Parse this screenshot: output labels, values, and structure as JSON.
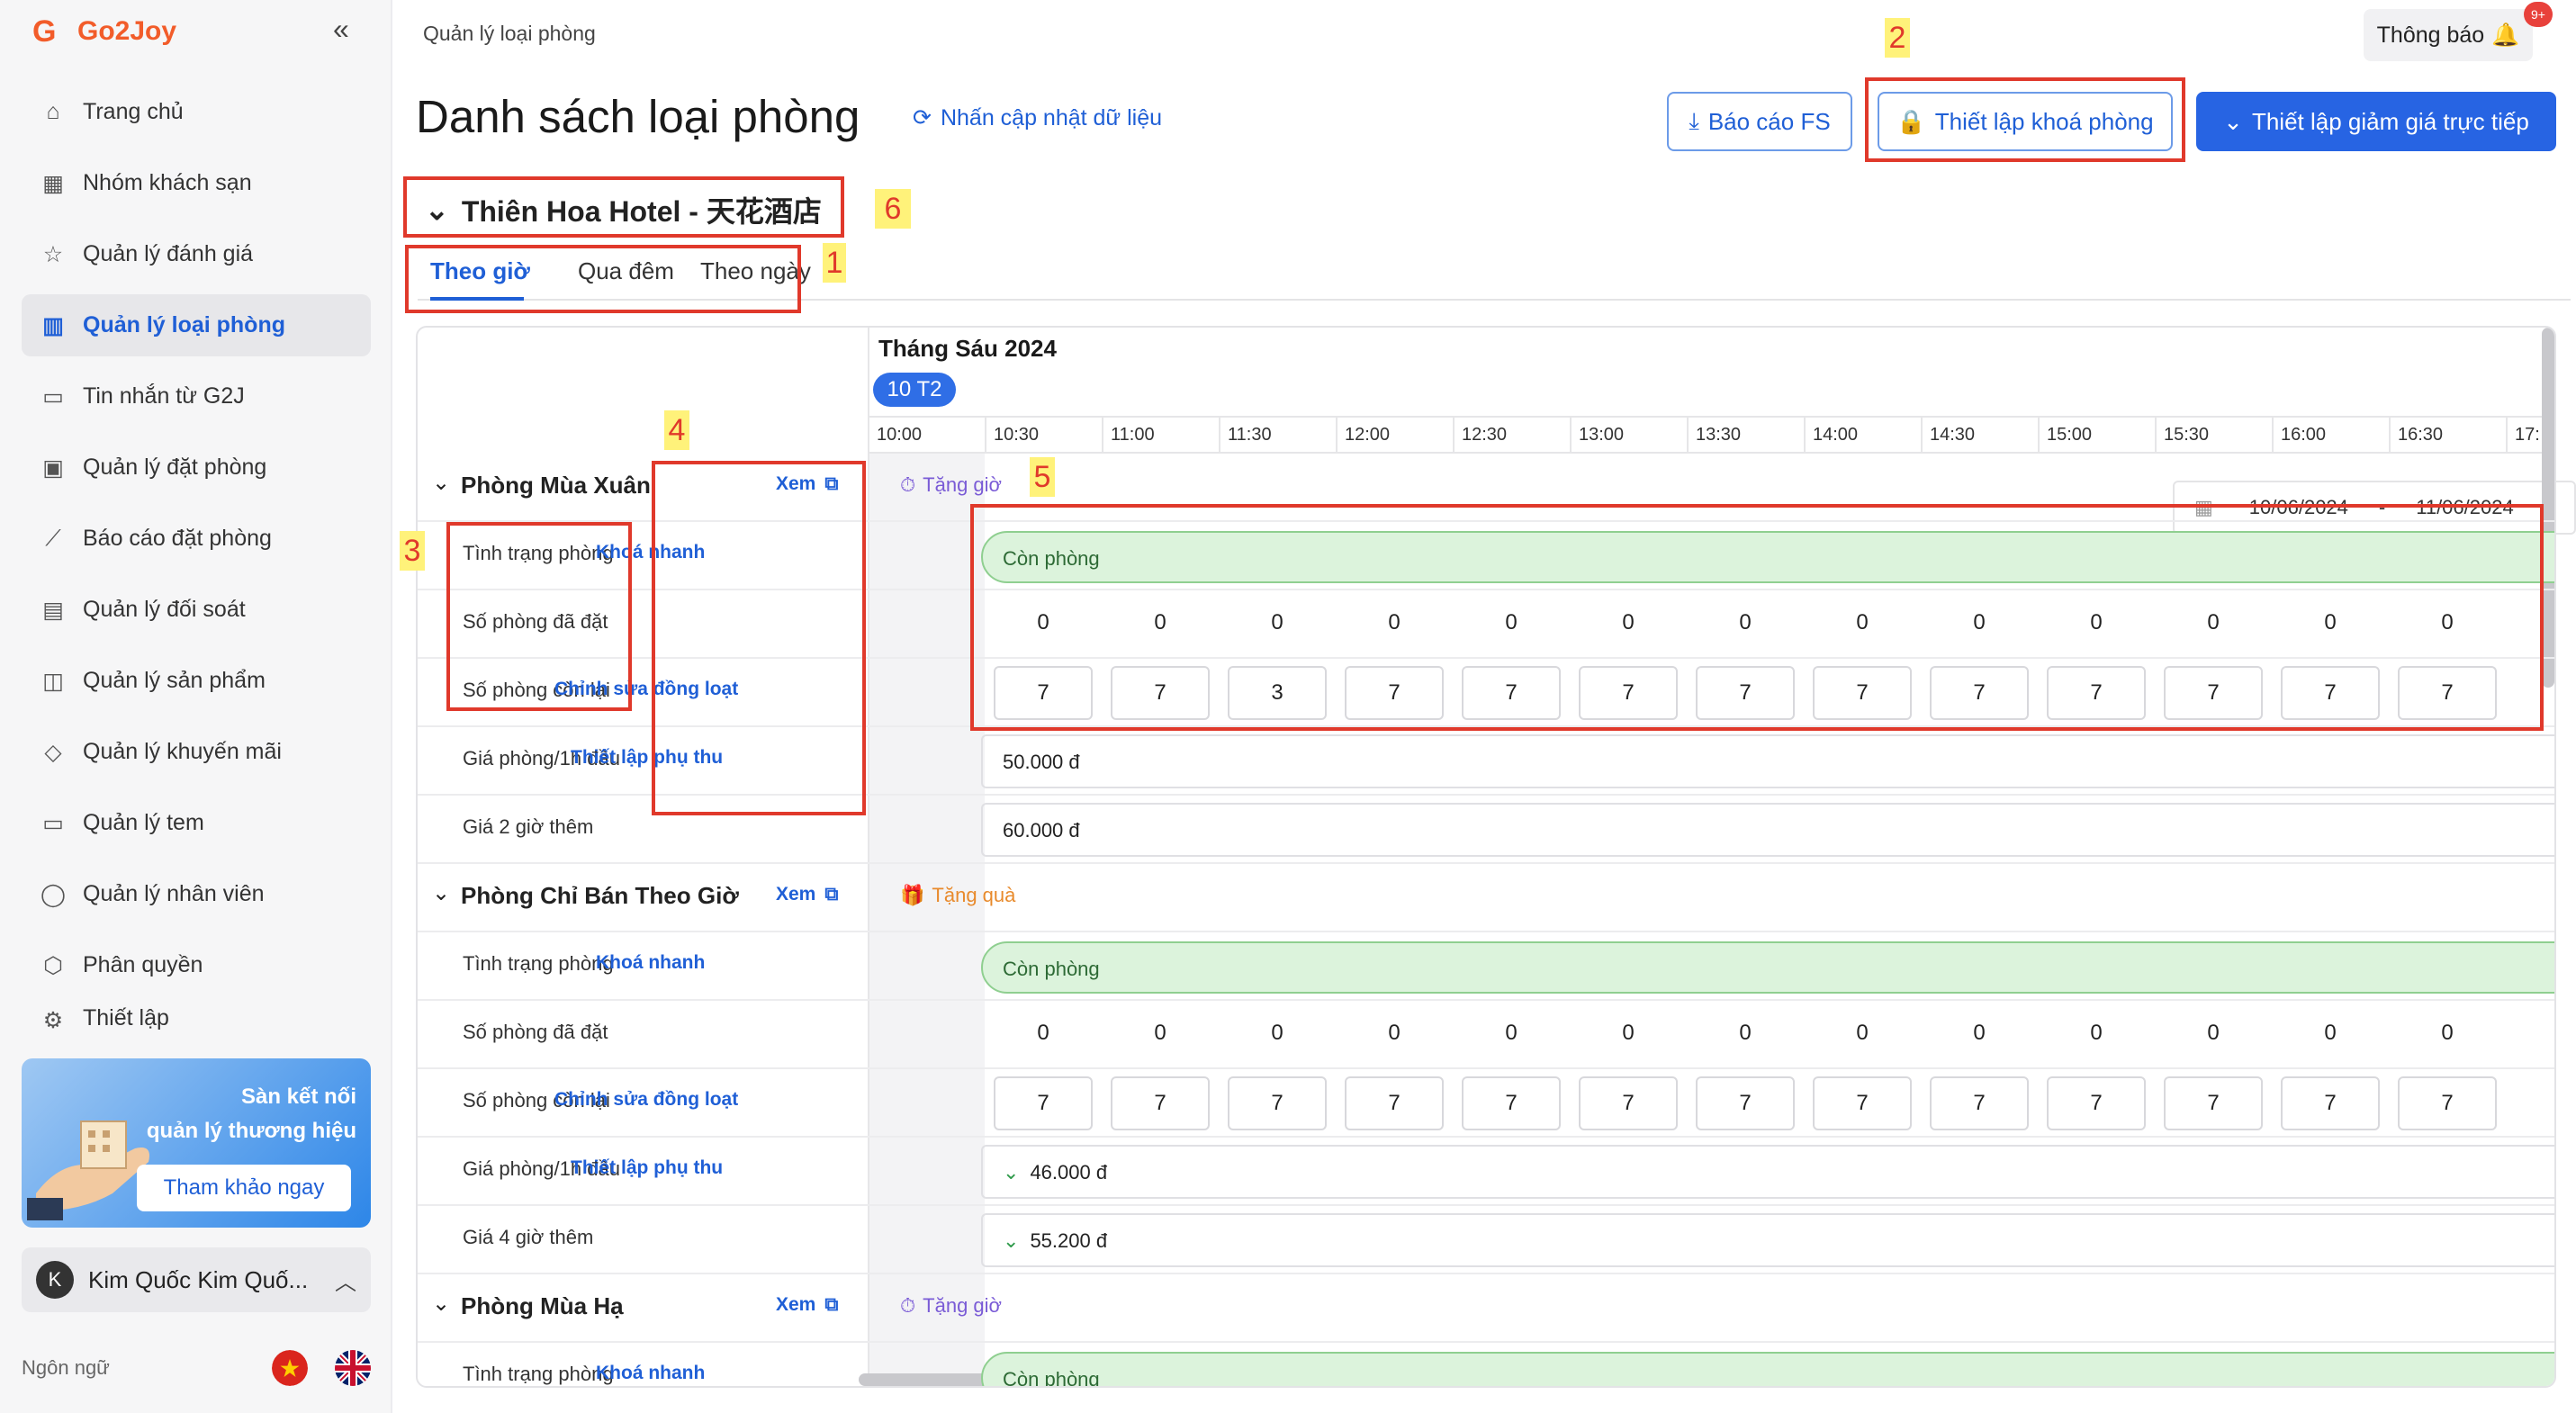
{
  "app": {
    "name": "Go2Joy"
  },
  "sidebar": {
    "items": [
      {
        "label": "Trang chủ",
        "icon": "home-icon"
      },
      {
        "label": "Nhóm khách sạn",
        "icon": "grid-icon"
      },
      {
        "label": "Quản lý đánh giá",
        "icon": "star-icon"
      },
      {
        "label": "Quản lý loại phòng",
        "icon": "building-icon",
        "active": true
      },
      {
        "label": "Tin nhắn từ G2J",
        "icon": "message-icon"
      },
      {
        "label": "Quản lý đặt phòng",
        "icon": "calendar-icon"
      },
      {
        "label": "Báo cáo đặt phòng",
        "icon": "chart-icon"
      },
      {
        "label": "Quản lý đối soát",
        "icon": "receipt-icon"
      },
      {
        "label": "Quản lý sản phẩm",
        "icon": "cup-icon"
      },
      {
        "label": "Quản lý khuyến mãi",
        "icon": "tag-icon"
      },
      {
        "label": "Quản lý tem",
        "icon": "ticket-icon"
      },
      {
        "label": "Quản lý nhân viên",
        "icon": "user-icon"
      },
      {
        "label": "Phân quyền",
        "icon": "shield-icon"
      },
      {
        "label": "Thiết lập",
        "icon": "settings-icon"
      }
    ],
    "promo": {
      "line1": "Sàn kết nối",
      "line2": "quản lý thương hiệu",
      "button": "Tham khảo ngay"
    },
    "user": {
      "initial": "K",
      "name": "Kim Quốc Kim Quố..."
    },
    "language_label": "Ngôn ngữ"
  },
  "header": {
    "breadcrumb": "Quản lý loại phòng",
    "notification_label": "Thông báo",
    "notification_badge": "9+",
    "title": "Danh sách loại phòng",
    "refresh_label": "Nhấn cập nhật dữ liệu",
    "btn_report": "Báo cáo FS",
    "btn_lock": "Thiết lập khoá phòng",
    "btn_discount": "Thiết lập giảm giá trực tiếp"
  },
  "hotel": {
    "name": "Thiên Hoa Hotel - 天花酒店"
  },
  "tabs": [
    "Theo giờ",
    "Qua đêm",
    "Theo ngày"
  ],
  "date_range": {
    "start": "10/06/2024",
    "sep": "-",
    "end": "11/06/2024"
  },
  "calendar": {
    "month": "Tháng Sáu 2024",
    "day": "10 T2",
    "times": [
      "10:00",
      "10:30",
      "11:00",
      "11:30",
      "12:00",
      "12:30",
      "13:00",
      "13:30",
      "14:00",
      "14:30",
      "15:00",
      "15:30",
      "16:00",
      "16:30",
      "17:"
    ]
  },
  "rooms": [
    {
      "name": "Phòng Mùa Xuân",
      "view": "Xem",
      "promo": "Tặng giờ",
      "rows": {
        "status": "Tình trạng phòng",
        "booked": "Số phòng đã đặt",
        "remaining": "Số phòng còn lại",
        "price1": "Giá phòng/1h đầu",
        "price2": "Giá 2 giờ thêm"
      },
      "actions": {
        "lock": "Khoá nhanh",
        "bulk": "Chỉnh sửa đồng loạt",
        "surcharge": "Thiết lập phụ thu"
      },
      "status_text": "Còn phòng",
      "booked": [
        0,
        0,
        0,
        0,
        0,
        0,
        0,
        0,
        0,
        0,
        0,
        0,
        0
      ],
      "remaining": [
        7,
        7,
        3,
        7,
        7,
        7,
        7,
        7,
        7,
        7,
        7,
        7,
        7
      ],
      "price1": "50.000 đ",
      "price2": "60.000 đ"
    },
    {
      "name": "Phòng Chỉ Bán Theo Giờ",
      "view": "Xem",
      "promo": "Tặng quà",
      "rows": {
        "status": "Tình trạng phòng",
        "booked": "Số phòng đã đặt",
        "remaining": "Số phòng còn lại",
        "price1": "Giá phòng/1h đầu",
        "price2": "Giá 4 giờ thêm"
      },
      "actions": {
        "lock": "Khoá nhanh",
        "bulk": "Chỉnh sửa đồng loạt",
        "surcharge": "Thiết lập phụ thu"
      },
      "status_text": "Còn phòng",
      "booked": [
        0,
        0,
        0,
        0,
        0,
        0,
        0,
        0,
        0,
        0,
        0,
        0,
        0
      ],
      "remaining": [
        7,
        7,
        7,
        7,
        7,
        7,
        7,
        7,
        7,
        7,
        7,
        7,
        7
      ],
      "price1": "46.000 đ",
      "price2": "55.200 đ"
    },
    {
      "name": "Phòng Mùa Hạ",
      "view": "Xem",
      "promo": "Tặng giờ",
      "rows": {
        "status": "Tình trạng phòng"
      },
      "actions": {
        "lock": "Khoá nhanh"
      },
      "status_text": "Còn phòng"
    }
  ],
  "annotations": [
    "1",
    "2",
    "3",
    "4",
    "5",
    "6"
  ],
  "colors": {
    "accent": "#1f5fd6",
    "primary_button": "#2764e3",
    "status_green": "#dcf3dc",
    "annotation_red": "#e0392b",
    "annotation_yellow": "#fff27a"
  }
}
